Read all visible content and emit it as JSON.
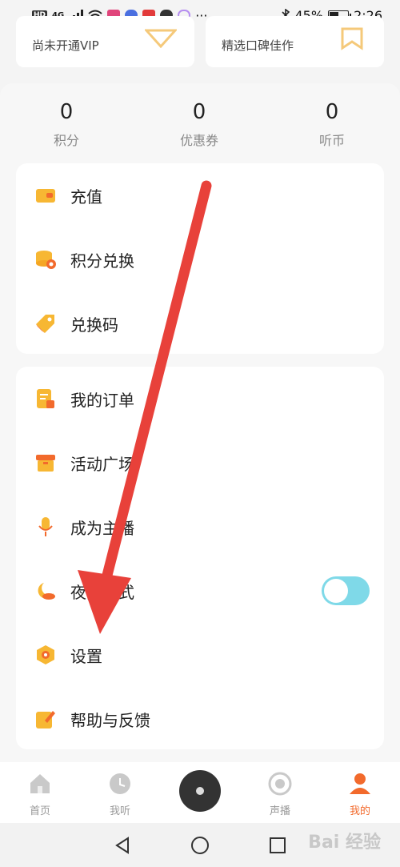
{
  "status_bar": {
    "left_label": "HD",
    "network": "4G",
    "battery": "45%",
    "battery_level": 0.45,
    "time": "2:26",
    "more": "···"
  },
  "vip": {
    "left_subtitle": "尚未开通VIP",
    "right_subtitle": "精选口碑佳作"
  },
  "stats": [
    {
      "value": "0",
      "label": "积分"
    },
    {
      "value": "0",
      "label": "优惠券"
    },
    {
      "value": "0",
      "label": "听币"
    }
  ],
  "menu_group_1": [
    {
      "label": "充值",
      "icon": "wallet-icon"
    },
    {
      "label": "积分兑换",
      "icon": "coins-icon"
    },
    {
      "label": "兑换码",
      "icon": "tag-icon"
    }
  ],
  "menu_group_2": [
    {
      "label": "我的订单",
      "icon": "order-icon"
    },
    {
      "label": "活动广场",
      "icon": "gift-icon"
    },
    {
      "label": "成为主播",
      "icon": "microphone-icon"
    },
    {
      "label": "夜间模式",
      "icon": "moon-icon",
      "toggle": false
    },
    {
      "label": "设置",
      "icon": "settings-icon"
    },
    {
      "label": "帮助与反馈",
      "icon": "edit-icon"
    }
  ],
  "bottom_nav": [
    {
      "label": "首页",
      "icon": "home-icon",
      "active": false
    },
    {
      "label": "我听",
      "icon": "clock-icon",
      "active": false
    },
    {
      "label": "",
      "icon": "player-disc-icon",
      "active": false
    },
    {
      "label": "声播",
      "icon": "sound-icon",
      "active": false
    },
    {
      "label": "我的",
      "icon": "user-icon",
      "active": true
    }
  ],
  "colors": {
    "accent": "#f26a2c",
    "icon_yellow": "#f7b733",
    "toggle": "#7fd9e8",
    "arrow": "#e8413a"
  },
  "watermark": "Bai 经验"
}
